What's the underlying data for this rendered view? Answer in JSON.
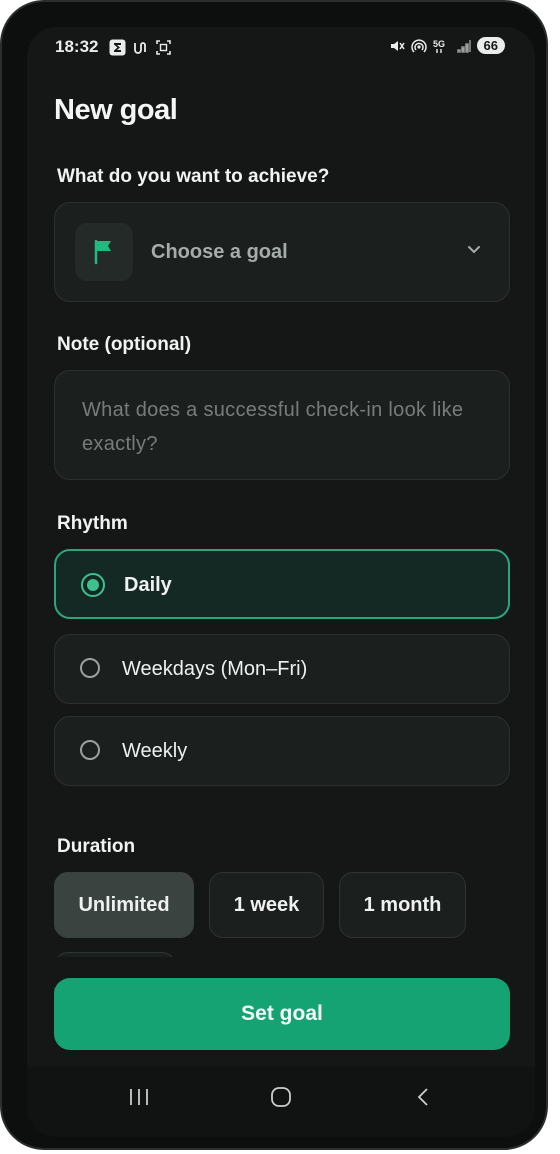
{
  "status_bar": {
    "time": "18:32",
    "battery": "66",
    "left_icons": [
      "sigma-icon",
      "loop-icon",
      "screenshot-icon"
    ],
    "right_icons": [
      "mute-icon",
      "hotspot-icon",
      "5g-icon",
      "signal-icon"
    ]
  },
  "page": {
    "title": "New goal"
  },
  "goal": {
    "label": "What do you want to achieve?",
    "placeholder": "Choose a goal",
    "icon": "flag-icon"
  },
  "note": {
    "label": "Note (optional)",
    "placeholder": "What does a successful check-in look like exactly?"
  },
  "rhythm": {
    "label": "Rhythm",
    "options": [
      {
        "label": "Daily",
        "selected": true
      },
      {
        "label": "Weekdays (Mon–Fri)",
        "selected": false
      },
      {
        "label": "Weekly",
        "selected": false
      }
    ]
  },
  "duration": {
    "label": "Duration",
    "options": [
      {
        "label": "Unlimited",
        "selected": true
      },
      {
        "label": "1 week",
        "selected": false
      },
      {
        "label": "1 month",
        "selected": false
      }
    ]
  },
  "cta": {
    "label": "Set goal"
  },
  "colors": {
    "accent": "#16a374",
    "selected_border": "#2fa37b",
    "background": "#141716"
  }
}
